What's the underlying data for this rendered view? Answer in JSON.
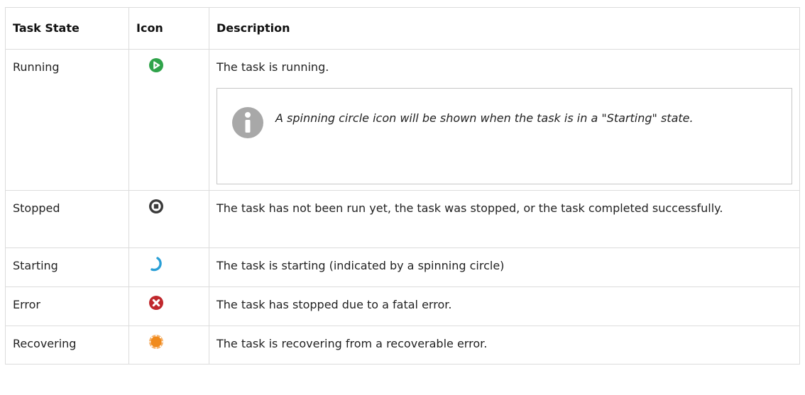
{
  "table": {
    "headers": {
      "task_state": "Task State",
      "icon": "Icon",
      "description": "Description"
    },
    "rows": [
      {
        "state": "Running",
        "icon": "running-play-icon",
        "description": "The task is running.",
        "note": "A spinning circle icon will be shown when the task is in a \"Starting\" state."
      },
      {
        "state": "Stopped",
        "icon": "stopped-square-icon",
        "description": "The task has not been run yet, the task was stopped, or the task completed successfully."
      },
      {
        "state": "Starting",
        "icon": "spinning-circle-icon",
        "description": "The task is starting (indicated by a spinning circle)"
      },
      {
        "state": "Error",
        "icon": "error-x-icon",
        "description": "The task has stopped due to a fatal error."
      },
      {
        "state": "Recovering",
        "icon": "recovering-sun-icon",
        "description": "The task is recovering from a recoverable error."
      }
    ]
  },
  "colors": {
    "running": "#2fa34a",
    "stopped": "#3a3a3a",
    "starting": "#2a9fd6",
    "error": "#c0282d",
    "recovering": "#f08a1c",
    "info_icon": "#a8a8a8",
    "border": "#dcdcdc"
  }
}
